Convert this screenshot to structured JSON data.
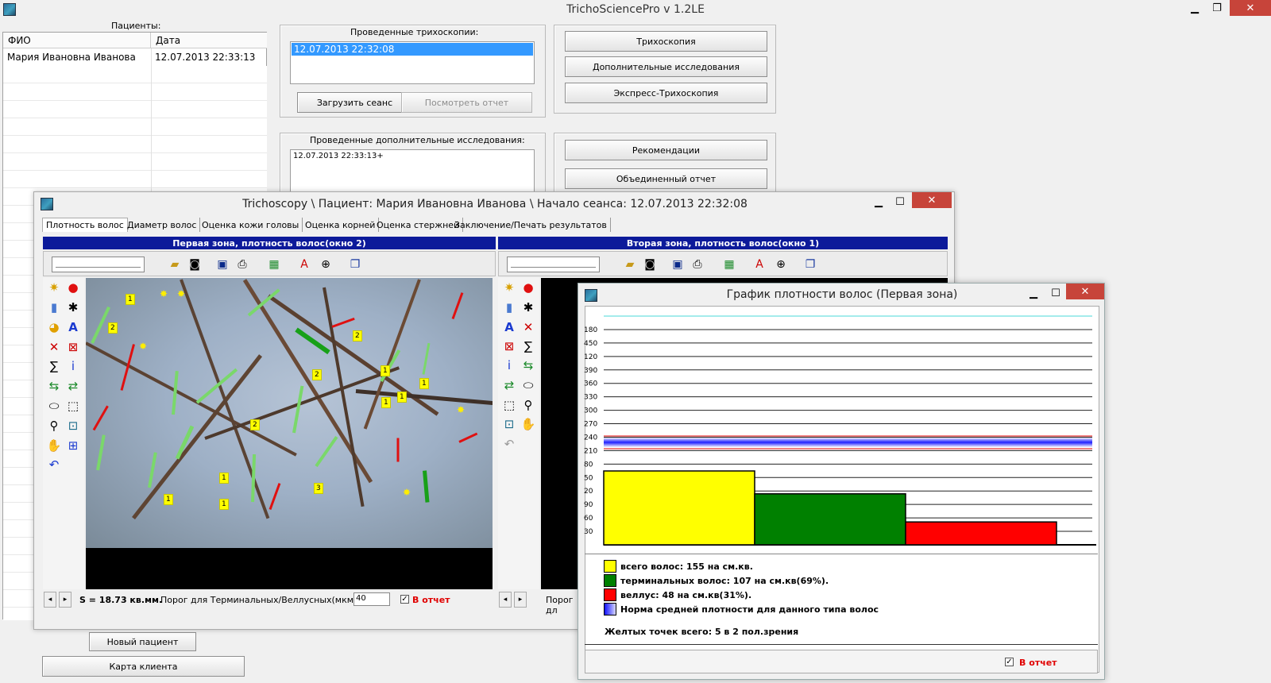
{
  "app": {
    "title": "TrichoSciencePro  v 1.2LE"
  },
  "patients": {
    "header": "Пациенты:",
    "col_name": "ФИО",
    "col_date": "Дата",
    "rows": [
      {
        "name": "Мария Ивановна Иванова",
        "date": "12.07.2013 22:33:13"
      }
    ],
    "new_patient_button": "Новый пациент",
    "client_card_button": "Карта клиента"
  },
  "trichoscopies": {
    "header": "Проведенные трихоскопии:",
    "items": [
      "12.07.2013 22:32:08"
    ],
    "load_button": "Загрузить сеанс",
    "view_report_button": "Посмотреть отчет"
  },
  "extra_studies": {
    "header": "Проведенные дополнительные исследования:",
    "items": [
      "12.07.2013 22:33:13+"
    ]
  },
  "actions": {
    "trichoscopy": "Трихоскопия",
    "additional": "Дополнительные исследования",
    "express": "Экспресс-Трихоскопия",
    "recommendations": "Рекомендации",
    "combined_report": "Объединенный отчет"
  },
  "session_window": {
    "title": "Trichoscopy  \\  Пациент: Мария Ивановна Иванова \\  Начало сеанса: 12.07.2013 22:32:08",
    "tabs": [
      "Плотность волос",
      "Диаметр волос",
      "Оценка кожи головы",
      "Оценка корней",
      "Оценка стержней",
      "Заключение/Печать результатов"
    ],
    "zone1_title": "Первая зона, плотность волос(окно 2)",
    "zone2_title": "Вторая зона, плотность волос(окно 1)",
    "area_label": "S = 18.73 кв.мм.",
    "threshold_label": "Порог для Терминальных/Веллусных(мкм):",
    "threshold_value": "40",
    "report_label": "В отчет",
    "threshold_label_short": "Порог дл",
    "labels_on_image": [
      "1",
      "2",
      "1",
      "2",
      "2",
      "1",
      "1",
      "1",
      "2",
      "1",
      "1",
      "1",
      "3"
    ]
  },
  "chart_window": {
    "title": "График плотности волос (Первая зона)",
    "legend": {
      "total": "всего волос: 155 на см.кв.",
      "terminal": "терминальных волос: 107 на см.кв(69%).",
      "vellus": "веллус: 48 на см.кв(31%).",
      "norm": "Норма средней плотности для данного типа волос"
    },
    "yellow_points": "Желтых точек  всего: 5 в 2 пол.зрения",
    "report_label": "В отчет"
  },
  "chart_data": {
    "type": "bar",
    "categories": [
      "всего волос",
      "терминальных волос",
      "веллус"
    ],
    "values": [
      155,
      107,
      48
    ],
    "colors": [
      "#ffff00",
      "#008000",
      "#ff0000"
    ],
    "ytick_labels": [
      "30",
      "60",
      "90",
      "20",
      "50",
      "80",
      "210",
      "240",
      "270",
      "300",
      "330",
      "360",
      "390",
      "120",
      "450",
      "180"
    ],
    "ylim": [
      0,
      480
    ],
    "norm_band": [
      205,
      225
    ],
    "norm_band_color": "#2020ff",
    "grid": true
  }
}
